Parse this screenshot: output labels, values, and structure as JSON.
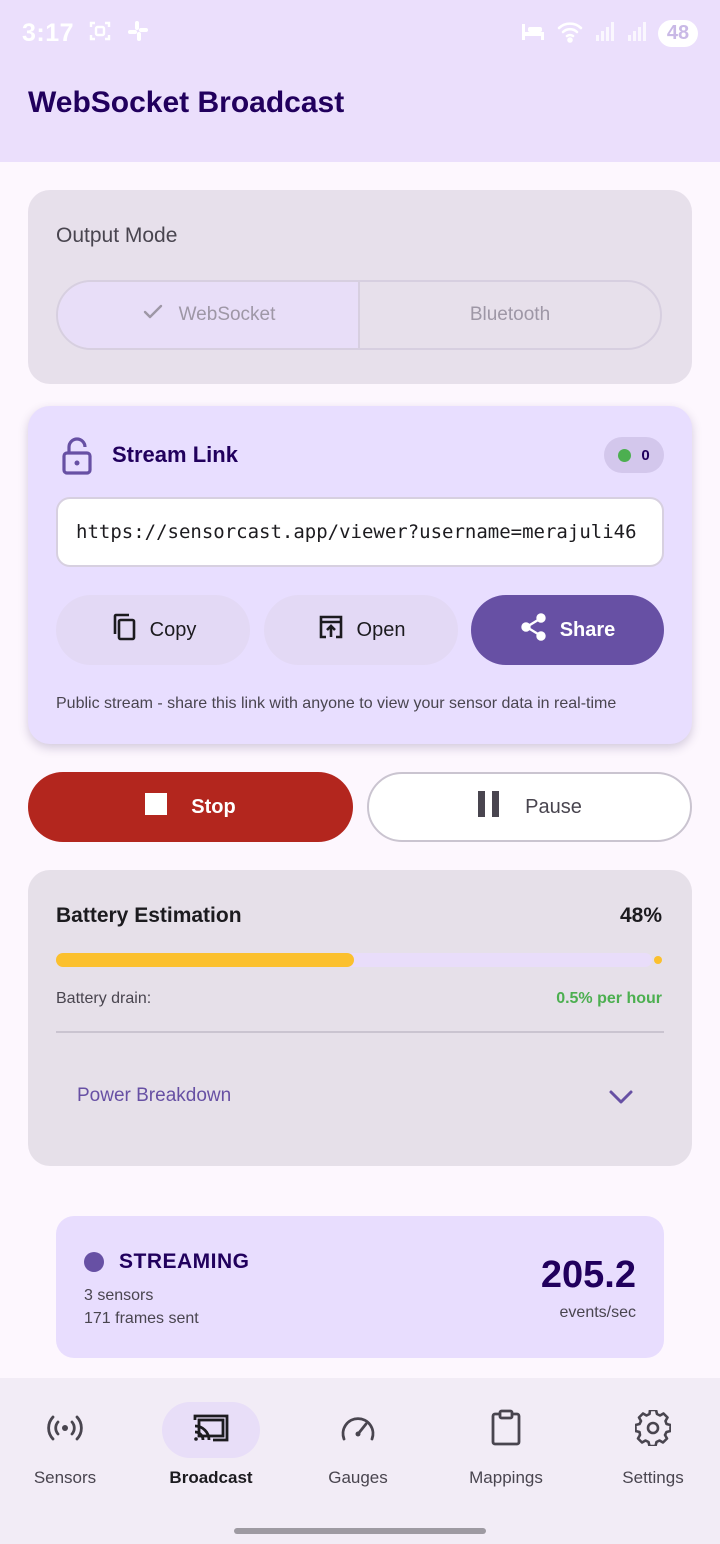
{
  "status_bar": {
    "time": "3:17",
    "battery_level": "48"
  },
  "app_bar": {
    "title": "WebSocket Broadcast"
  },
  "output_mode": {
    "title": "Output Mode",
    "options": [
      {
        "label": "WebSocket",
        "selected": true
      },
      {
        "label": "Bluetooth",
        "selected": false
      }
    ]
  },
  "stream_link": {
    "title": "Stream Link",
    "client_count": "0",
    "url": "https://sensorcast.app/viewer?username=merajuli46",
    "buttons": {
      "copy": "Copy",
      "open": "Open",
      "share": "Share"
    },
    "description": "Public stream - share this link with anyone to view your sensor data in real-time"
  },
  "controls": {
    "stop": "Stop",
    "pause": "Pause"
  },
  "battery": {
    "title": "Battery Estimation",
    "percent_label": "48%",
    "progress_fraction": 0.5,
    "drain_label": "Battery drain:",
    "drain_value": "0.5% per hour",
    "breakdown_label": "Power Breakdown"
  },
  "streaming_status": {
    "state": "STREAMING",
    "sensors": "3 sensors",
    "frames": "171 frames sent",
    "rate": "205.2",
    "rate_unit": "events/sec"
  },
  "nav": {
    "items": [
      {
        "label": "Sensors",
        "icon": "sensors-icon",
        "active": false
      },
      {
        "label": "Broadcast",
        "icon": "cast-icon",
        "active": true
      },
      {
        "label": "Gauges",
        "icon": "speed-gauge-icon",
        "active": false
      },
      {
        "label": "Mappings",
        "icon": "clipboard-icon",
        "active": false
      },
      {
        "label": "Settings",
        "icon": "gear-icon",
        "active": false
      }
    ]
  },
  "colors": {
    "primary": "#6750a4",
    "stop": "#b3261e",
    "battery": "#fbc02d",
    "success": "#4caf50",
    "title": "#21005d"
  }
}
